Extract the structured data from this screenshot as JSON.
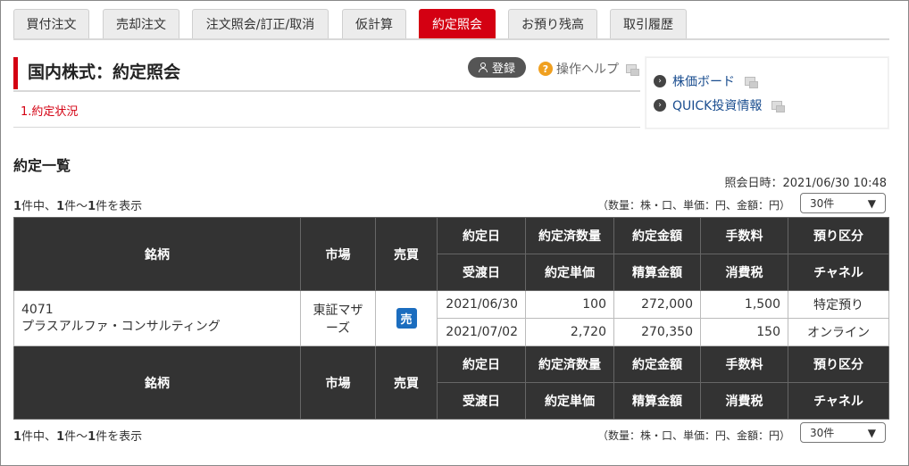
{
  "tabs": [
    {
      "label": "買付注文",
      "active": false
    },
    {
      "label": "売却注文",
      "active": false
    },
    {
      "label": "注文照会/訂正/取消",
      "active": false
    },
    {
      "label": "仮計算",
      "active": false
    },
    {
      "label": "約定照会",
      "active": true
    },
    {
      "label": "お預り残高",
      "active": false
    },
    {
      "label": "取引履歴",
      "active": false
    }
  ],
  "header": {
    "title": "国内株式：約定照会",
    "login_label": "登録",
    "help_label": "操作ヘルプ",
    "step": "1.約定状況"
  },
  "side_links": [
    "株価ボード",
    "QUICK投資情報"
  ],
  "list": {
    "title": "約定一覧",
    "query_time": "照会日時：2021/06/30 10:48",
    "count_prefix": "件中、",
    "count_total": "1",
    "count_from": "1",
    "count_sep": "件～",
    "count_to": "1",
    "count_suffix": "件を表示",
    "units": "（数量：株・口、単価：円、金額：円）",
    "page_size": "30件"
  },
  "table": {
    "headers": {
      "stock": "銘柄",
      "market": "市場",
      "trade": "売買",
      "row1": [
        "約定日",
        "約定済数量",
        "約定金額",
        "手数料",
        "預り区分"
      ],
      "row2": [
        "受渡日",
        "約定単価",
        "精算金額",
        "消費税",
        "チャネル"
      ]
    },
    "rows": [
      {
        "code": "4071",
        "name": "プラスアルファ・コンサルティング",
        "market": "東証マザーズ",
        "trade": "売",
        "line1": [
          "2021/06/30",
          "100",
          "272,000",
          "1,500",
          "特定預り"
        ],
        "line2": [
          "2021/07/02",
          "2,720",
          "270,350",
          "150",
          "オンライン"
        ]
      }
    ]
  },
  "colors": {
    "accent": "#d40012",
    "header_bg": "#333333",
    "sell": "#1b6dbf"
  }
}
